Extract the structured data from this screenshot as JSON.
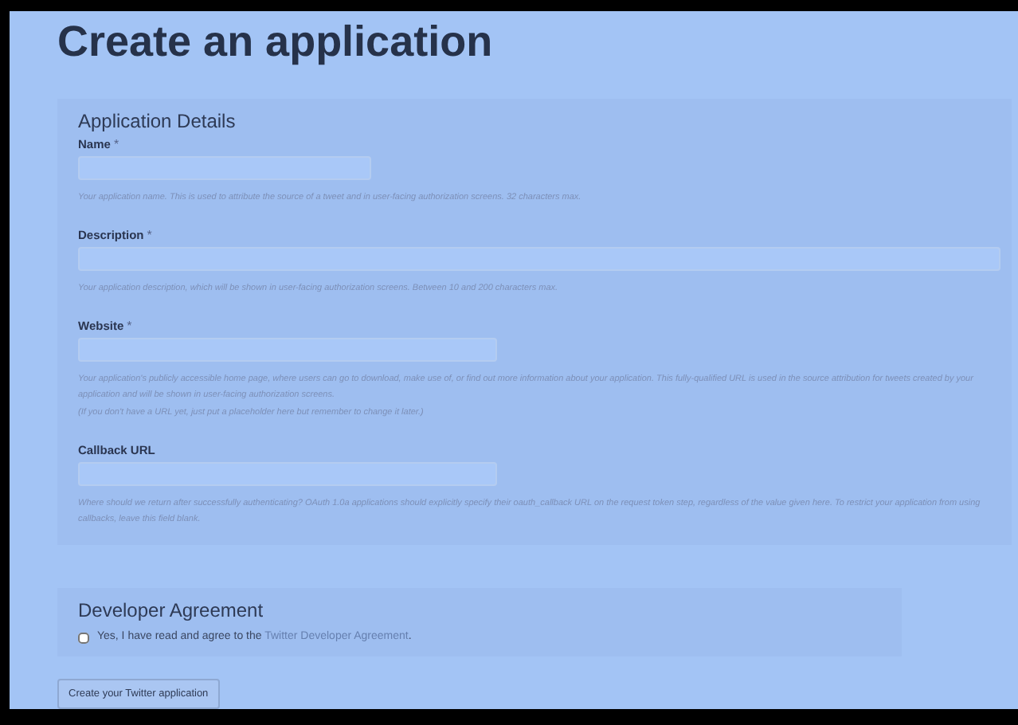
{
  "title": "Create an application",
  "details": {
    "heading": "Application Details",
    "fields": [
      {
        "label": "Name",
        "mark": "*",
        "kind": "short",
        "help": [
          "Your application name. This is used to attribute the source of a tweet and in user-facing authorization screens. 32 characters max."
        ]
      },
      {
        "label": "Description",
        "mark": "*",
        "kind": "wide",
        "help": [
          "Your application description, which will be shown in user-facing authorization screens. Between 10 and 200 characters max."
        ]
      },
      {
        "label": "Website",
        "mark": "*",
        "kind": "medium",
        "help": [
          "Your application's publicly accessible home page, where users can go to download, make use of, or find out more information about your application. This fully-qualified URL is used in the source attribution for tweets created by your application and will be shown in user-facing authorization screens.",
          "(If you don't have a URL yet, just put a placeholder here but remember to change it later.)"
        ]
      },
      {
        "label": "Callback URL",
        "kind": "medium",
        "help": [
          "Where should we return after successfully authenticating? OAuth 1.0a applications should explicitly specify their oauth_callback URL on the request token step, regardless of the value given here. To restrict your application from using callbacks, leave this field blank."
        ]
      }
    ]
  },
  "agreement": {
    "heading": "Developer Agreement",
    "checked": false,
    "text": "Yes, I have read and agree to the",
    "link": "Twitter Developer Agreement",
    "after": "."
  },
  "submit": "Create your Twitter application"
}
